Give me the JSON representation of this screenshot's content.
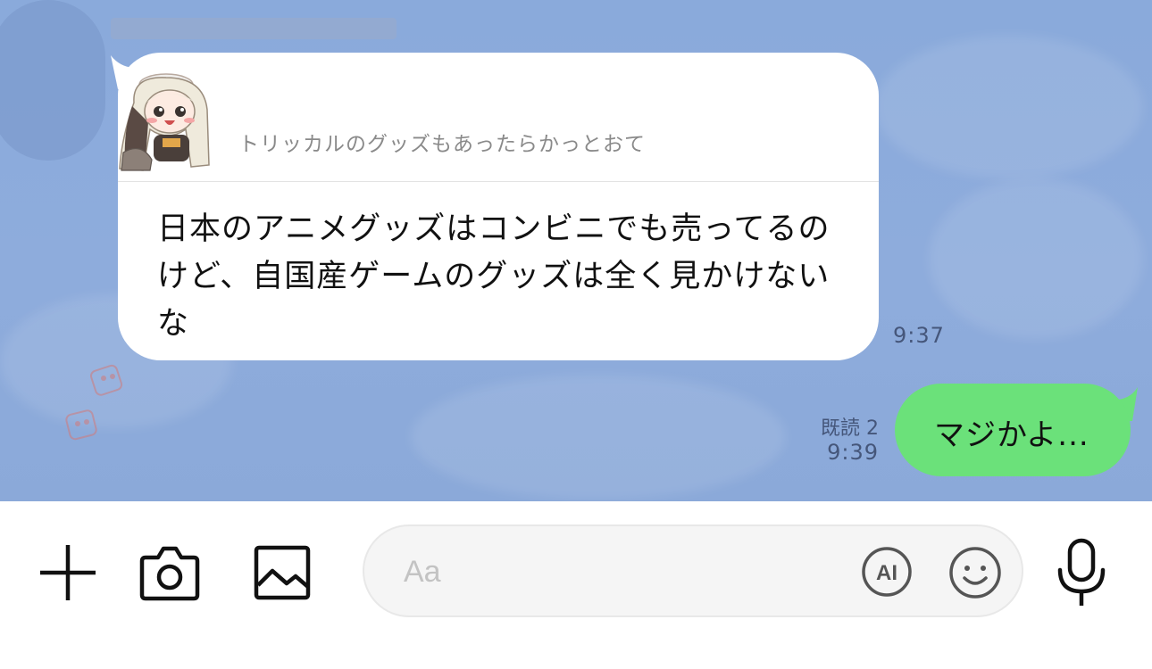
{
  "chat": {
    "incoming": {
      "reply_preview_text": "トリッカルのグッズもあったらかっとおて",
      "message_lines": [
        "日本のアニメグッズはコンビニでも売ってるの",
        "けど、自国産ゲームのグッズは全く見かけない",
        "な"
      ],
      "time": "9:37"
    },
    "outgoing": {
      "message": "マジかよ...",
      "read_receipt": "既読 2",
      "time": "9:39"
    }
  },
  "input_bar": {
    "placeholder": "Aa",
    "ai_label": "AI",
    "icons": {
      "add": "plus-icon",
      "camera": "camera-icon",
      "image": "image-icon",
      "ai": "ai-icon",
      "emoji": "smiley-icon",
      "mic": "microphone-icon"
    }
  },
  "colors": {
    "chat_background": "#8eacdc",
    "outgoing_bubble": "#6be17a",
    "incoming_bubble": "#ffffff",
    "timestamp": "#45567a",
    "placeholder": "#c3c3c3"
  }
}
